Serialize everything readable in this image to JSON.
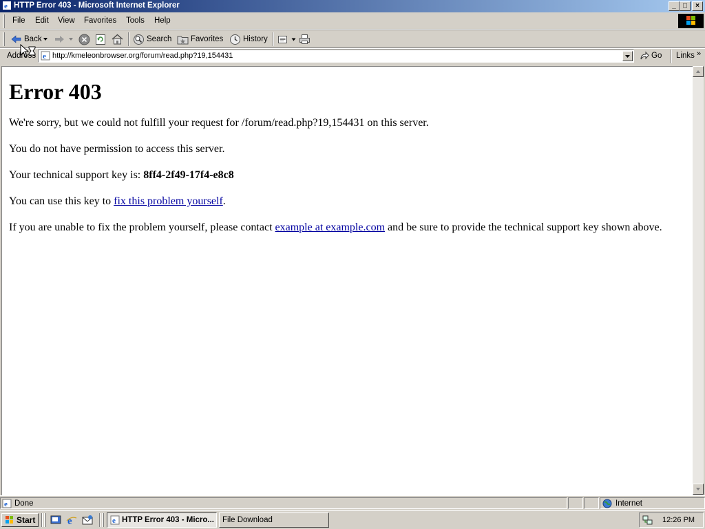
{
  "window": {
    "title": "HTTP Error 403 - Microsoft Internet Explorer",
    "controls": [
      "_",
      "□",
      "×"
    ]
  },
  "menu": [
    "File",
    "Edit",
    "View",
    "Favorites",
    "Tools",
    "Help"
  ],
  "toolbar": {
    "back_label": "Back",
    "search_label": "Search",
    "favorites_label": "Favorites",
    "history_label": "History"
  },
  "address": {
    "label": "Address",
    "url": "http://kmeleonbrowser.org/forum/read.php?19,154431",
    "go_label": "Go",
    "links_label": "Links"
  },
  "page": {
    "heading": "Error 403",
    "p1": "We're sorry, but we could not fulfill your request for /forum/read.php?19,154431 on this server.",
    "p2": "You do not have permission to access this server.",
    "p3_prefix": "Your technical support key is: ",
    "support_key": "8ff4-2f49-17f4-e8c8",
    "p4_prefix": "You can use this key to ",
    "p4_link": "fix this problem yourself",
    "p4_suffix": ".",
    "p5_prefix": "If you are unable to fix the problem yourself, please contact ",
    "p5_link": "example at example.com",
    "p5_suffix": " and be sure to provide the technical support key shown above."
  },
  "status": {
    "text": "Done",
    "zone": "Internet"
  },
  "taskbar": {
    "start_label": "Start",
    "tasks": [
      "HTTP Error 403 - Micro...",
      "File Download"
    ],
    "clock": "12:26 PM"
  },
  "colors": {
    "titlebar_start": "#0a246a",
    "titlebar_end": "#a6caf0",
    "link": "#0000a0",
    "chrome": "#d4d0c8"
  }
}
